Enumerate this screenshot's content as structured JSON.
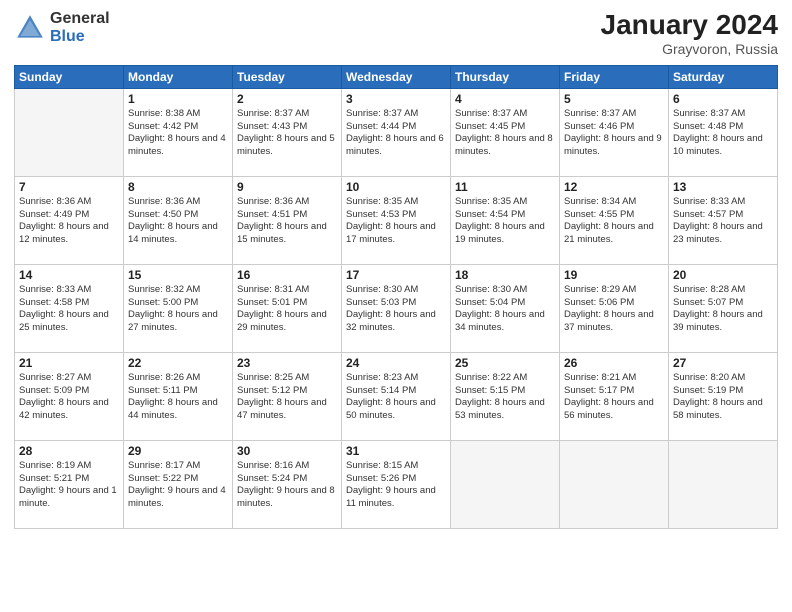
{
  "logo": {
    "general": "General",
    "blue": "Blue"
  },
  "title": "January 2024",
  "location": "Grayvoron, Russia",
  "days_of_week": [
    "Sunday",
    "Monday",
    "Tuesday",
    "Wednesday",
    "Thursday",
    "Friday",
    "Saturday"
  ],
  "weeks": [
    [
      {
        "day": "",
        "sunrise": "",
        "sunset": "",
        "daylight": ""
      },
      {
        "day": "1",
        "sunrise": "Sunrise: 8:38 AM",
        "sunset": "Sunset: 4:42 PM",
        "daylight": "Daylight: 8 hours and 4 minutes."
      },
      {
        "day": "2",
        "sunrise": "Sunrise: 8:37 AM",
        "sunset": "Sunset: 4:43 PM",
        "daylight": "Daylight: 8 hours and 5 minutes."
      },
      {
        "day": "3",
        "sunrise": "Sunrise: 8:37 AM",
        "sunset": "Sunset: 4:44 PM",
        "daylight": "Daylight: 8 hours and 6 minutes."
      },
      {
        "day": "4",
        "sunrise": "Sunrise: 8:37 AM",
        "sunset": "Sunset: 4:45 PM",
        "daylight": "Daylight: 8 hours and 8 minutes."
      },
      {
        "day": "5",
        "sunrise": "Sunrise: 8:37 AM",
        "sunset": "Sunset: 4:46 PM",
        "daylight": "Daylight: 8 hours and 9 minutes."
      },
      {
        "day": "6",
        "sunrise": "Sunrise: 8:37 AM",
        "sunset": "Sunset: 4:48 PM",
        "daylight": "Daylight: 8 hours and 10 minutes."
      }
    ],
    [
      {
        "day": "7",
        "sunrise": "Sunrise: 8:36 AM",
        "sunset": "Sunset: 4:49 PM",
        "daylight": "Daylight: 8 hours and 12 minutes."
      },
      {
        "day": "8",
        "sunrise": "Sunrise: 8:36 AM",
        "sunset": "Sunset: 4:50 PM",
        "daylight": "Daylight: 8 hours and 14 minutes."
      },
      {
        "day": "9",
        "sunrise": "Sunrise: 8:36 AM",
        "sunset": "Sunset: 4:51 PM",
        "daylight": "Daylight: 8 hours and 15 minutes."
      },
      {
        "day": "10",
        "sunrise": "Sunrise: 8:35 AM",
        "sunset": "Sunset: 4:53 PM",
        "daylight": "Daylight: 8 hours and 17 minutes."
      },
      {
        "day": "11",
        "sunrise": "Sunrise: 8:35 AM",
        "sunset": "Sunset: 4:54 PM",
        "daylight": "Daylight: 8 hours and 19 minutes."
      },
      {
        "day": "12",
        "sunrise": "Sunrise: 8:34 AM",
        "sunset": "Sunset: 4:55 PM",
        "daylight": "Daylight: 8 hours and 21 minutes."
      },
      {
        "day": "13",
        "sunrise": "Sunrise: 8:33 AM",
        "sunset": "Sunset: 4:57 PM",
        "daylight": "Daylight: 8 hours and 23 minutes."
      }
    ],
    [
      {
        "day": "14",
        "sunrise": "Sunrise: 8:33 AM",
        "sunset": "Sunset: 4:58 PM",
        "daylight": "Daylight: 8 hours and 25 minutes."
      },
      {
        "day": "15",
        "sunrise": "Sunrise: 8:32 AM",
        "sunset": "Sunset: 5:00 PM",
        "daylight": "Daylight: 8 hours and 27 minutes."
      },
      {
        "day": "16",
        "sunrise": "Sunrise: 8:31 AM",
        "sunset": "Sunset: 5:01 PM",
        "daylight": "Daylight: 8 hours and 29 minutes."
      },
      {
        "day": "17",
        "sunrise": "Sunrise: 8:30 AM",
        "sunset": "Sunset: 5:03 PM",
        "daylight": "Daylight: 8 hours and 32 minutes."
      },
      {
        "day": "18",
        "sunrise": "Sunrise: 8:30 AM",
        "sunset": "Sunset: 5:04 PM",
        "daylight": "Daylight: 8 hours and 34 minutes."
      },
      {
        "day": "19",
        "sunrise": "Sunrise: 8:29 AM",
        "sunset": "Sunset: 5:06 PM",
        "daylight": "Daylight: 8 hours and 37 minutes."
      },
      {
        "day": "20",
        "sunrise": "Sunrise: 8:28 AM",
        "sunset": "Sunset: 5:07 PM",
        "daylight": "Daylight: 8 hours and 39 minutes."
      }
    ],
    [
      {
        "day": "21",
        "sunrise": "Sunrise: 8:27 AM",
        "sunset": "Sunset: 5:09 PM",
        "daylight": "Daylight: 8 hours and 42 minutes."
      },
      {
        "day": "22",
        "sunrise": "Sunrise: 8:26 AM",
        "sunset": "Sunset: 5:11 PM",
        "daylight": "Daylight: 8 hours and 44 minutes."
      },
      {
        "day": "23",
        "sunrise": "Sunrise: 8:25 AM",
        "sunset": "Sunset: 5:12 PM",
        "daylight": "Daylight: 8 hours and 47 minutes."
      },
      {
        "day": "24",
        "sunrise": "Sunrise: 8:23 AM",
        "sunset": "Sunset: 5:14 PM",
        "daylight": "Daylight: 8 hours and 50 minutes."
      },
      {
        "day": "25",
        "sunrise": "Sunrise: 8:22 AM",
        "sunset": "Sunset: 5:15 PM",
        "daylight": "Daylight: 8 hours and 53 minutes."
      },
      {
        "day": "26",
        "sunrise": "Sunrise: 8:21 AM",
        "sunset": "Sunset: 5:17 PM",
        "daylight": "Daylight: 8 hours and 56 minutes."
      },
      {
        "day": "27",
        "sunrise": "Sunrise: 8:20 AM",
        "sunset": "Sunset: 5:19 PM",
        "daylight": "Daylight: 8 hours and 58 minutes."
      }
    ],
    [
      {
        "day": "28",
        "sunrise": "Sunrise: 8:19 AM",
        "sunset": "Sunset: 5:21 PM",
        "daylight": "Daylight: 9 hours and 1 minute."
      },
      {
        "day": "29",
        "sunrise": "Sunrise: 8:17 AM",
        "sunset": "Sunset: 5:22 PM",
        "daylight": "Daylight: 9 hours and 4 minutes."
      },
      {
        "day": "30",
        "sunrise": "Sunrise: 8:16 AM",
        "sunset": "Sunset: 5:24 PM",
        "daylight": "Daylight: 9 hours and 8 minutes."
      },
      {
        "day": "31",
        "sunrise": "Sunrise: 8:15 AM",
        "sunset": "Sunset: 5:26 PM",
        "daylight": "Daylight: 9 hours and 11 minutes."
      },
      {
        "day": "",
        "sunrise": "",
        "sunset": "",
        "daylight": ""
      },
      {
        "day": "",
        "sunrise": "",
        "sunset": "",
        "daylight": ""
      },
      {
        "day": "",
        "sunrise": "",
        "sunset": "",
        "daylight": ""
      }
    ]
  ]
}
